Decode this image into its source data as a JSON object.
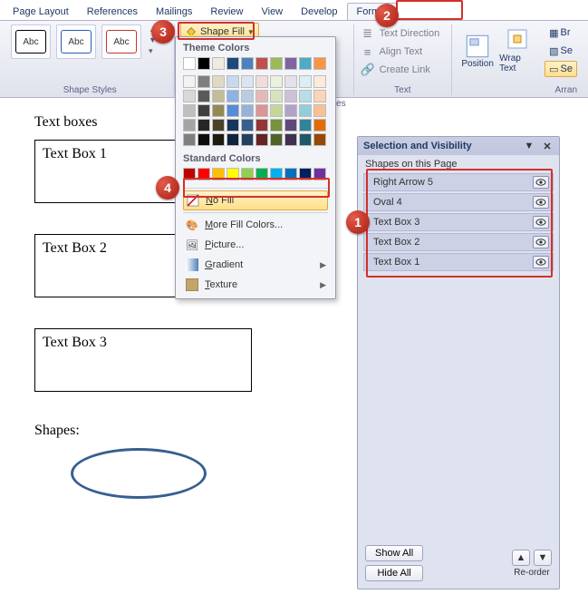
{
  "tabs": {
    "page_layout": "Page Layout",
    "references": "References",
    "mailings": "Mailings",
    "review": "Review",
    "view": "View",
    "developer": "Develop",
    "format": "Format"
  },
  "ribbon": {
    "shape_styles_group": "Shape Styles",
    "sample_text": "Abc",
    "shape_fill_label": "Shape Fill",
    "wordart_group_hint": "yles",
    "text_group": "Text",
    "text_direction": "Text Direction",
    "align_text": "Align Text",
    "create_link": "Create Link",
    "position": "Position",
    "wrap_text": "Wrap Text",
    "arrange": "Arran",
    "bring": "Br",
    "send": "Se",
    "selection": "Se"
  },
  "fill_dropdown": {
    "theme_label": "Theme Colors",
    "standard_label": "Standard Colors",
    "no_fill": "No Fill",
    "more_colors": "More Fill Colors...",
    "picture": "Picture...",
    "gradient": "Gradient",
    "texture": "Texture",
    "theme_row1": [
      "#ffffff",
      "#000000",
      "#eeece1",
      "#1f497d",
      "#4f81bd",
      "#c0504d",
      "#9bbb59",
      "#8064a2",
      "#4bacc6",
      "#f79646"
    ],
    "theme_tints": [
      [
        "#f2f2f2",
        "#7f7f7f",
        "#ddd9c3",
        "#c6d9f0",
        "#dbe5f1",
        "#f2dcdb",
        "#ebf1dd",
        "#e5e0ec",
        "#dbeef3",
        "#fdeada"
      ],
      [
        "#d8d8d8",
        "#595959",
        "#c4bd97",
        "#8db3e2",
        "#b8cce4",
        "#e5b9b7",
        "#d7e3bc",
        "#ccc1d9",
        "#b7dde8",
        "#fbd5b5"
      ],
      [
        "#bfbfbf",
        "#3f3f3f",
        "#938953",
        "#548dd4",
        "#95b3d7",
        "#d99694",
        "#c3d69b",
        "#b2a2c7",
        "#92cddc",
        "#fac08f"
      ],
      [
        "#a5a5a5",
        "#262626",
        "#494429",
        "#17365d",
        "#366092",
        "#953734",
        "#76923c",
        "#5f497a",
        "#31859b",
        "#e36c09"
      ],
      [
        "#7f7f7f",
        "#0c0c0c",
        "#1d1b10",
        "#0f243e",
        "#244061",
        "#632423",
        "#4f6128",
        "#3f3151",
        "#205867",
        "#974806"
      ]
    ],
    "standard": [
      "#c00000",
      "#ff0000",
      "#ffc000",
      "#ffff00",
      "#92d050",
      "#00b050",
      "#00b0f0",
      "#0070c0",
      "#002060",
      "#7030a0"
    ]
  },
  "document": {
    "text_boxes_label": "Text boxes",
    "tb1": "Text Box 1",
    "tb2": "Text Box 2",
    "tb3": "Text Box 3",
    "shapes_label": "Shapes:"
  },
  "selection_pane": {
    "title": "Selection and Visibility",
    "subtitle": "Shapes on this Page",
    "items": [
      "Right Arrow 5",
      "Oval 4",
      "Text Box 3",
      "Text Box 2",
      "Text Box 1"
    ],
    "show_all": "Show All",
    "hide_all": "Hide All",
    "reorder": "Re-order"
  },
  "callouts": {
    "c1": "1",
    "c2": "2",
    "c3": "3",
    "c4": "4"
  }
}
